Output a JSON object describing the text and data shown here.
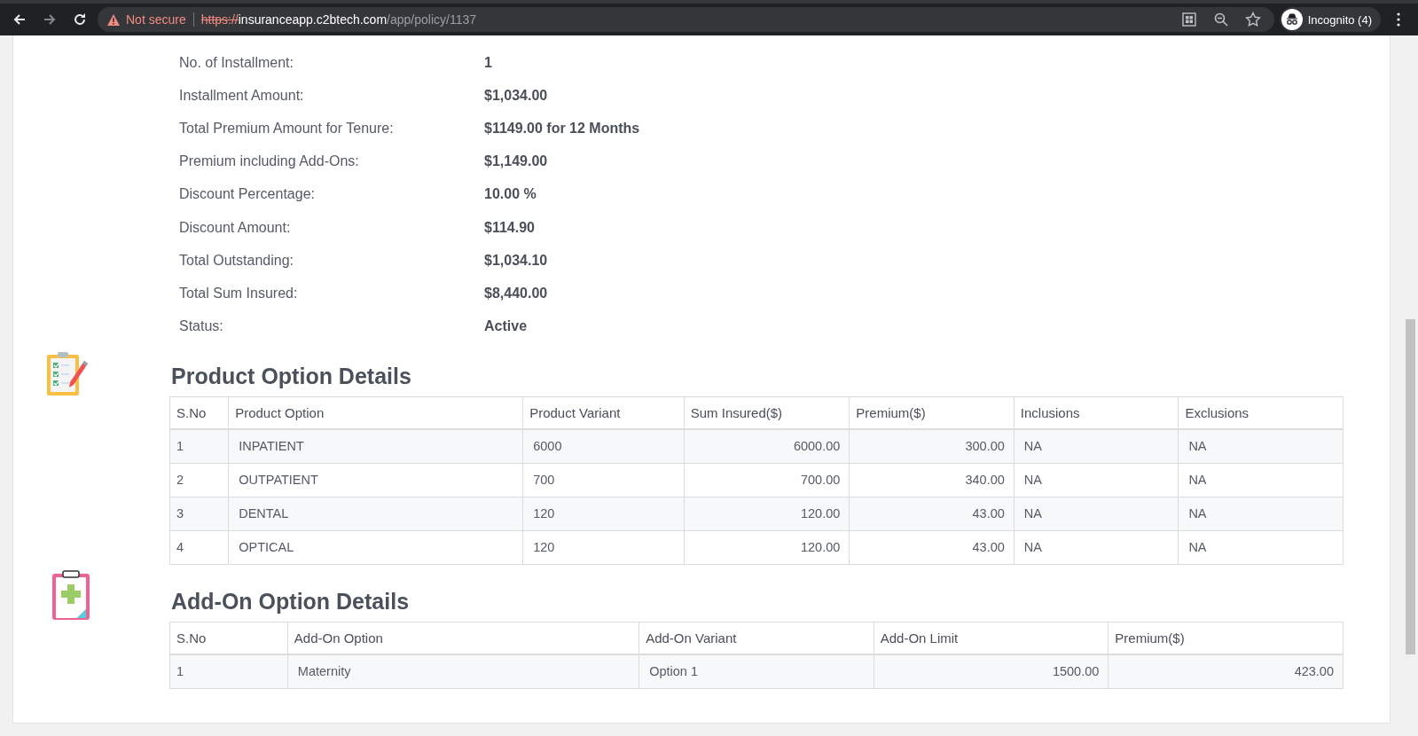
{
  "browser": {
    "not_secure": "Not secure",
    "url_scheme": "https://",
    "url_host": "insuranceapp.c2btech.com",
    "url_path": "/app/policy/1137",
    "profile": "Incognito (4)"
  },
  "details": [
    {
      "label": "No. of Installment:",
      "value": "1"
    },
    {
      "label": "Installment Amount:",
      "value": "$1,034.00"
    },
    {
      "label": "Total Premium Amount for Tenure:",
      "value": "$1149.00 for 12 Months"
    },
    {
      "label": "Premium including Add-Ons:",
      "value": "$1,149.00"
    },
    {
      "label": "Discount Percentage:",
      "value": "10.00 %"
    },
    {
      "label": "Discount Amount:",
      "value": "$114.90"
    },
    {
      "label": "Total Outstanding:",
      "value": "$1,034.10"
    },
    {
      "label": "Total Sum Insured:",
      "value": "$8,440.00"
    },
    {
      "label": "Status:",
      "value": "Active"
    }
  ],
  "product_options": {
    "title": "Product Option Details",
    "columns": [
      "S.No",
      "Product Option",
      "Product Variant",
      "Sum Insured($)",
      "Premium($)",
      "Inclusions",
      "Exclusions"
    ],
    "rows": [
      [
        "1",
        "INPATIENT",
        "6000",
        "6000.00",
        "300.00",
        "NA",
        "NA"
      ],
      [
        "2",
        "OUTPATIENT",
        "700",
        "700.00",
        "340.00",
        "NA",
        "NA"
      ],
      [
        "3",
        "DENTAL",
        "120",
        "120.00",
        "43.00",
        "NA",
        "NA"
      ],
      [
        "4",
        "OPTICAL",
        "120",
        "120.00",
        "43.00",
        "NA",
        "NA"
      ]
    ]
  },
  "addon_options": {
    "title": "Add-On Option Details",
    "columns": [
      "S.No",
      "Add-On Option",
      "Add-On Variant",
      "Add-On Limit",
      "Premium($)"
    ],
    "rows": [
      [
        "1",
        "Maternity",
        "Option 1",
        "1500.00",
        "423.00"
      ]
    ]
  }
}
